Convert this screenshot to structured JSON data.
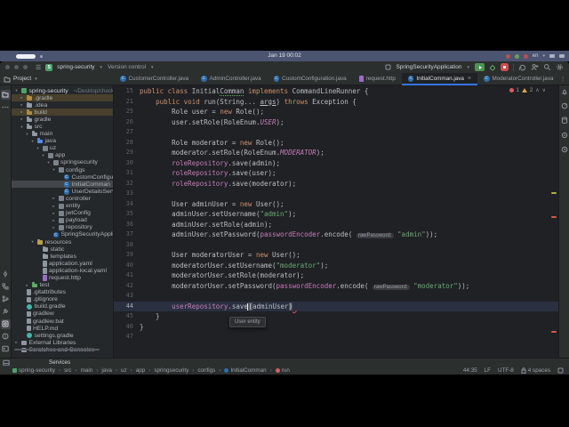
{
  "desktop": {
    "clock": "Jan 19 00:02",
    "keyboard_layout": "en"
  },
  "title_bar": {
    "project_button": "spring-security",
    "vcs_button": "Version control",
    "run_config": "SpringSecurityApplication"
  },
  "panel_header": {
    "label": "Project"
  },
  "tabs": [
    {
      "icon": "class",
      "label": "CustomerController.java"
    },
    {
      "icon": "class",
      "label": "AdminController.java"
    },
    {
      "icon": "class",
      "label": "CustomConfiguration.java"
    },
    {
      "icon": "http",
      "label": "request.http"
    },
    {
      "icon": "class",
      "label": "InitialComman.java",
      "active": true,
      "close": true
    },
    {
      "icon": "class",
      "label": "ModeratorController.java"
    }
  ],
  "project_tree": [
    {
      "d": 0,
      "i": "project",
      "l": "spring-security",
      "x": "~/Desktop/checkup/spring-sec",
      "c": 1,
      "root": true
    },
    {
      "d": 1,
      "i": "folder-ex",
      "l": ".gradle",
      "c": 0,
      "hl": true
    },
    {
      "d": 1,
      "i": "folder",
      "l": ".idea",
      "c": 0
    },
    {
      "d": 1,
      "i": "folder-ex",
      "l": "build",
      "c": 0,
      "hl": true
    },
    {
      "d": 1,
      "i": "folder",
      "l": "gradle",
      "c": 0
    },
    {
      "d": 1,
      "i": "folder",
      "l": "src",
      "c": 1
    },
    {
      "d": 2,
      "i": "folder",
      "l": "main",
      "c": 1
    },
    {
      "d": 3,
      "i": "folder-src",
      "l": "java",
      "c": 1
    },
    {
      "d": 4,
      "i": "package",
      "l": "uz",
      "c": 1
    },
    {
      "d": 5,
      "i": "package",
      "l": "app",
      "c": 1
    },
    {
      "d": 6,
      "i": "package",
      "l": "springsecurity",
      "c": 1
    },
    {
      "d": 7,
      "i": "package",
      "l": "configs",
      "c": 1
    },
    {
      "d": 8,
      "i": "class",
      "l": "CustomConfiguration"
    },
    {
      "d": 8,
      "i": "class",
      "l": "InitialComman",
      "sel": true
    },
    {
      "d": 8,
      "i": "class",
      "l": "UserDetailsServiceImp"
    },
    {
      "d": 7,
      "i": "package",
      "l": "controller",
      "c": 0
    },
    {
      "d": 7,
      "i": "package",
      "l": "entity",
      "c": 0
    },
    {
      "d": 7,
      "i": "package",
      "l": "jwtConfig",
      "c": 0
    },
    {
      "d": 7,
      "i": "package",
      "l": "payload",
      "c": 0
    },
    {
      "d": 7,
      "i": "package",
      "l": "repository",
      "c": 0
    },
    {
      "d": 6,
      "i": "class",
      "l": "SpringSecurityApplication"
    },
    {
      "d": 3,
      "i": "folder-res",
      "l": "resources",
      "c": 1
    },
    {
      "d": 4,
      "i": "folder",
      "l": "static"
    },
    {
      "d": 4,
      "i": "folder",
      "l": "templates"
    },
    {
      "d": 4,
      "i": "yaml",
      "l": "application.yaml"
    },
    {
      "d": 4,
      "i": "yaml",
      "l": "application-local.yaml"
    },
    {
      "d": 4,
      "i": "http",
      "l": "request.http"
    },
    {
      "d": 2,
      "i": "folder-test",
      "l": "test",
      "c": 0
    },
    {
      "d": 1,
      "i": "file",
      "l": ".gitattributes"
    },
    {
      "d": 1,
      "i": "file",
      "l": ".gitignore"
    },
    {
      "d": 1,
      "i": "gradle",
      "l": "build.gradle"
    },
    {
      "d": 1,
      "i": "file",
      "l": "gradlew"
    },
    {
      "d": 1,
      "i": "file",
      "l": "gradlew.bat"
    },
    {
      "d": 1,
      "i": "md",
      "l": "HELP.md"
    },
    {
      "d": 1,
      "i": "gradle",
      "l": "settings.gradle"
    },
    {
      "d": 0,
      "i": "lib",
      "l": "External Libraries",
      "c": 0
    },
    {
      "d": 0,
      "i": "scratch",
      "l": "Scratches and Consoles",
      "c": 0
    }
  ],
  "editor": {
    "popup": "User entity",
    "inspections": {
      "errors": "1",
      "warnings": "2"
    },
    "lines": [
      {
        "n": 15,
        "t": [
          [
            "k",
            "public "
          ],
          [
            "k",
            "class "
          ],
          [
            "d",
            "Initial"
          ],
          [
            "t",
            "Comman"
          ],
          [
            "d",
            " "
          ],
          [
            "k",
            "implements "
          ],
          [
            "d",
            "CommandLineRunner {"
          ]
        ]
      },
      {
        "n": 21,
        "t": [
          [
            "d",
            "    "
          ],
          [
            "k",
            "public "
          ],
          [
            "k",
            "void "
          ],
          [
            "d",
            "run(String... "
          ],
          [
            "u",
            "args"
          ],
          [
            "d",
            ") "
          ],
          [
            "k",
            "throws "
          ],
          [
            "d",
            "Exception {"
          ]
        ]
      },
      {
        "n": 25,
        "t": [
          [
            "d",
            "        Role user = "
          ],
          [
            "k",
            "new "
          ],
          [
            "d",
            "Role();"
          ]
        ]
      },
      {
        "n": 26,
        "t": [
          [
            "d",
            "        user.setRole(RoleEnum."
          ],
          [
            "c",
            "USER"
          ],
          [
            "d",
            ");"
          ]
        ]
      },
      {
        "n": 27,
        "t": []
      },
      {
        "n": 28,
        "t": [
          [
            "d",
            "        Role moderator = "
          ],
          [
            "k",
            "new "
          ],
          [
            "d",
            "Role();"
          ]
        ]
      },
      {
        "n": 29,
        "t": [
          [
            "d",
            "        moderator.setRole(RoleEnum."
          ],
          [
            "c",
            "MODERATOR"
          ],
          [
            "d",
            ");"
          ]
        ]
      },
      {
        "n": 30,
        "t": [
          [
            "d",
            "        "
          ],
          [
            "f",
            "roleRepository"
          ],
          [
            "d",
            ".save(admin);"
          ]
        ]
      },
      {
        "n": 31,
        "t": [
          [
            "d",
            "        "
          ],
          [
            "f",
            "roleRepository"
          ],
          [
            "d",
            ".save(user);"
          ]
        ]
      },
      {
        "n": 32,
        "t": [
          [
            "d",
            "        "
          ],
          [
            "f",
            "roleRepository"
          ],
          [
            "d",
            ".save(moderator);"
          ]
        ]
      },
      {
        "n": 33,
        "t": []
      },
      {
        "n": 34,
        "t": [
          [
            "d",
            "        User adminUser = "
          ],
          [
            "k",
            "new "
          ],
          [
            "d",
            "User();"
          ]
        ]
      },
      {
        "n": 35,
        "t": [
          [
            "d",
            "        adminUser.setUsername("
          ],
          [
            "s",
            "\"admin\""
          ],
          [
            "d",
            ");"
          ]
        ]
      },
      {
        "n": 36,
        "t": [
          [
            "d",
            "        adminUser.setRole(admin);"
          ]
        ]
      },
      {
        "n": 37,
        "t": [
          [
            "d",
            "        adminUser.setPassword("
          ],
          [
            "f",
            "passwordEncoder"
          ],
          [
            "d",
            ".encode( "
          ],
          [
            "i",
            "rawPassword:"
          ],
          [
            "d",
            " "
          ],
          [
            "s",
            "\"admin\""
          ],
          [
            "d",
            "));"
          ]
        ]
      },
      {
        "n": 38,
        "t": []
      },
      {
        "n": 39,
        "t": [
          [
            "d",
            "        User moderatorUser = "
          ],
          [
            "k",
            "new "
          ],
          [
            "d",
            "User();"
          ]
        ]
      },
      {
        "n": 40,
        "t": [
          [
            "d",
            "        moderatorUser.setUsername("
          ],
          [
            "s",
            "\"moderator\""
          ],
          [
            "d",
            ");"
          ]
        ]
      },
      {
        "n": 41,
        "t": [
          [
            "d",
            "        moderatorUser.setRole(moderator);"
          ]
        ]
      },
      {
        "n": 42,
        "t": [
          [
            "d",
            "        moderatorUser.setPassword("
          ],
          [
            "f",
            "passwordEncoder"
          ],
          [
            "d",
            ".encode( "
          ],
          [
            "i",
            "rawPassword:"
          ],
          [
            "d",
            " "
          ],
          [
            "s",
            "\"moderator\""
          ],
          [
            "d",
            "));"
          ]
        ]
      },
      {
        "n": 43,
        "t": []
      },
      {
        "n": 44,
        "cur": true,
        "t": [
          [
            "d",
            "        "
          ],
          [
            "f",
            "userRepository"
          ],
          [
            "d",
            ".save"
          ],
          [
            "caret",
            ""
          ],
          [
            "b",
            "("
          ],
          [
            "d",
            "adminUser"
          ],
          [
            "b",
            ")"
          ],
          [
            "e",
            " "
          ]
        ]
      },
      {
        "n": 45,
        "t": [
          [
            "d",
            "    }"
          ]
        ]
      },
      {
        "n": 46,
        "t": [
          [
            "d",
            "}"
          ]
        ]
      },
      {
        "n": 47,
        "t": []
      }
    ]
  },
  "breadcrumbs": [
    {
      "i": "project",
      "l": "spring-security"
    },
    {
      "l": "src"
    },
    {
      "l": "main"
    },
    {
      "l": "java"
    },
    {
      "l": "uz"
    },
    {
      "l": "app"
    },
    {
      "l": "springsecurity"
    },
    {
      "l": "configs"
    },
    {
      "i": "class",
      "l": "InitialComman"
    },
    {
      "i": "method",
      "l": "run"
    }
  ],
  "bottom_strip": {
    "label": "Services"
  },
  "status_bar": {
    "caret": "44:35",
    "line_ending": "LF",
    "encoding": "UTF-8",
    "indent": "4 spaces"
  },
  "colors": {
    "accent": "#3574f0",
    "run_green": "#4d9352",
    "stop_red": "#c94f4f",
    "error_red": "#db5c5c",
    "warning_yellow": "#d9a343"
  }
}
